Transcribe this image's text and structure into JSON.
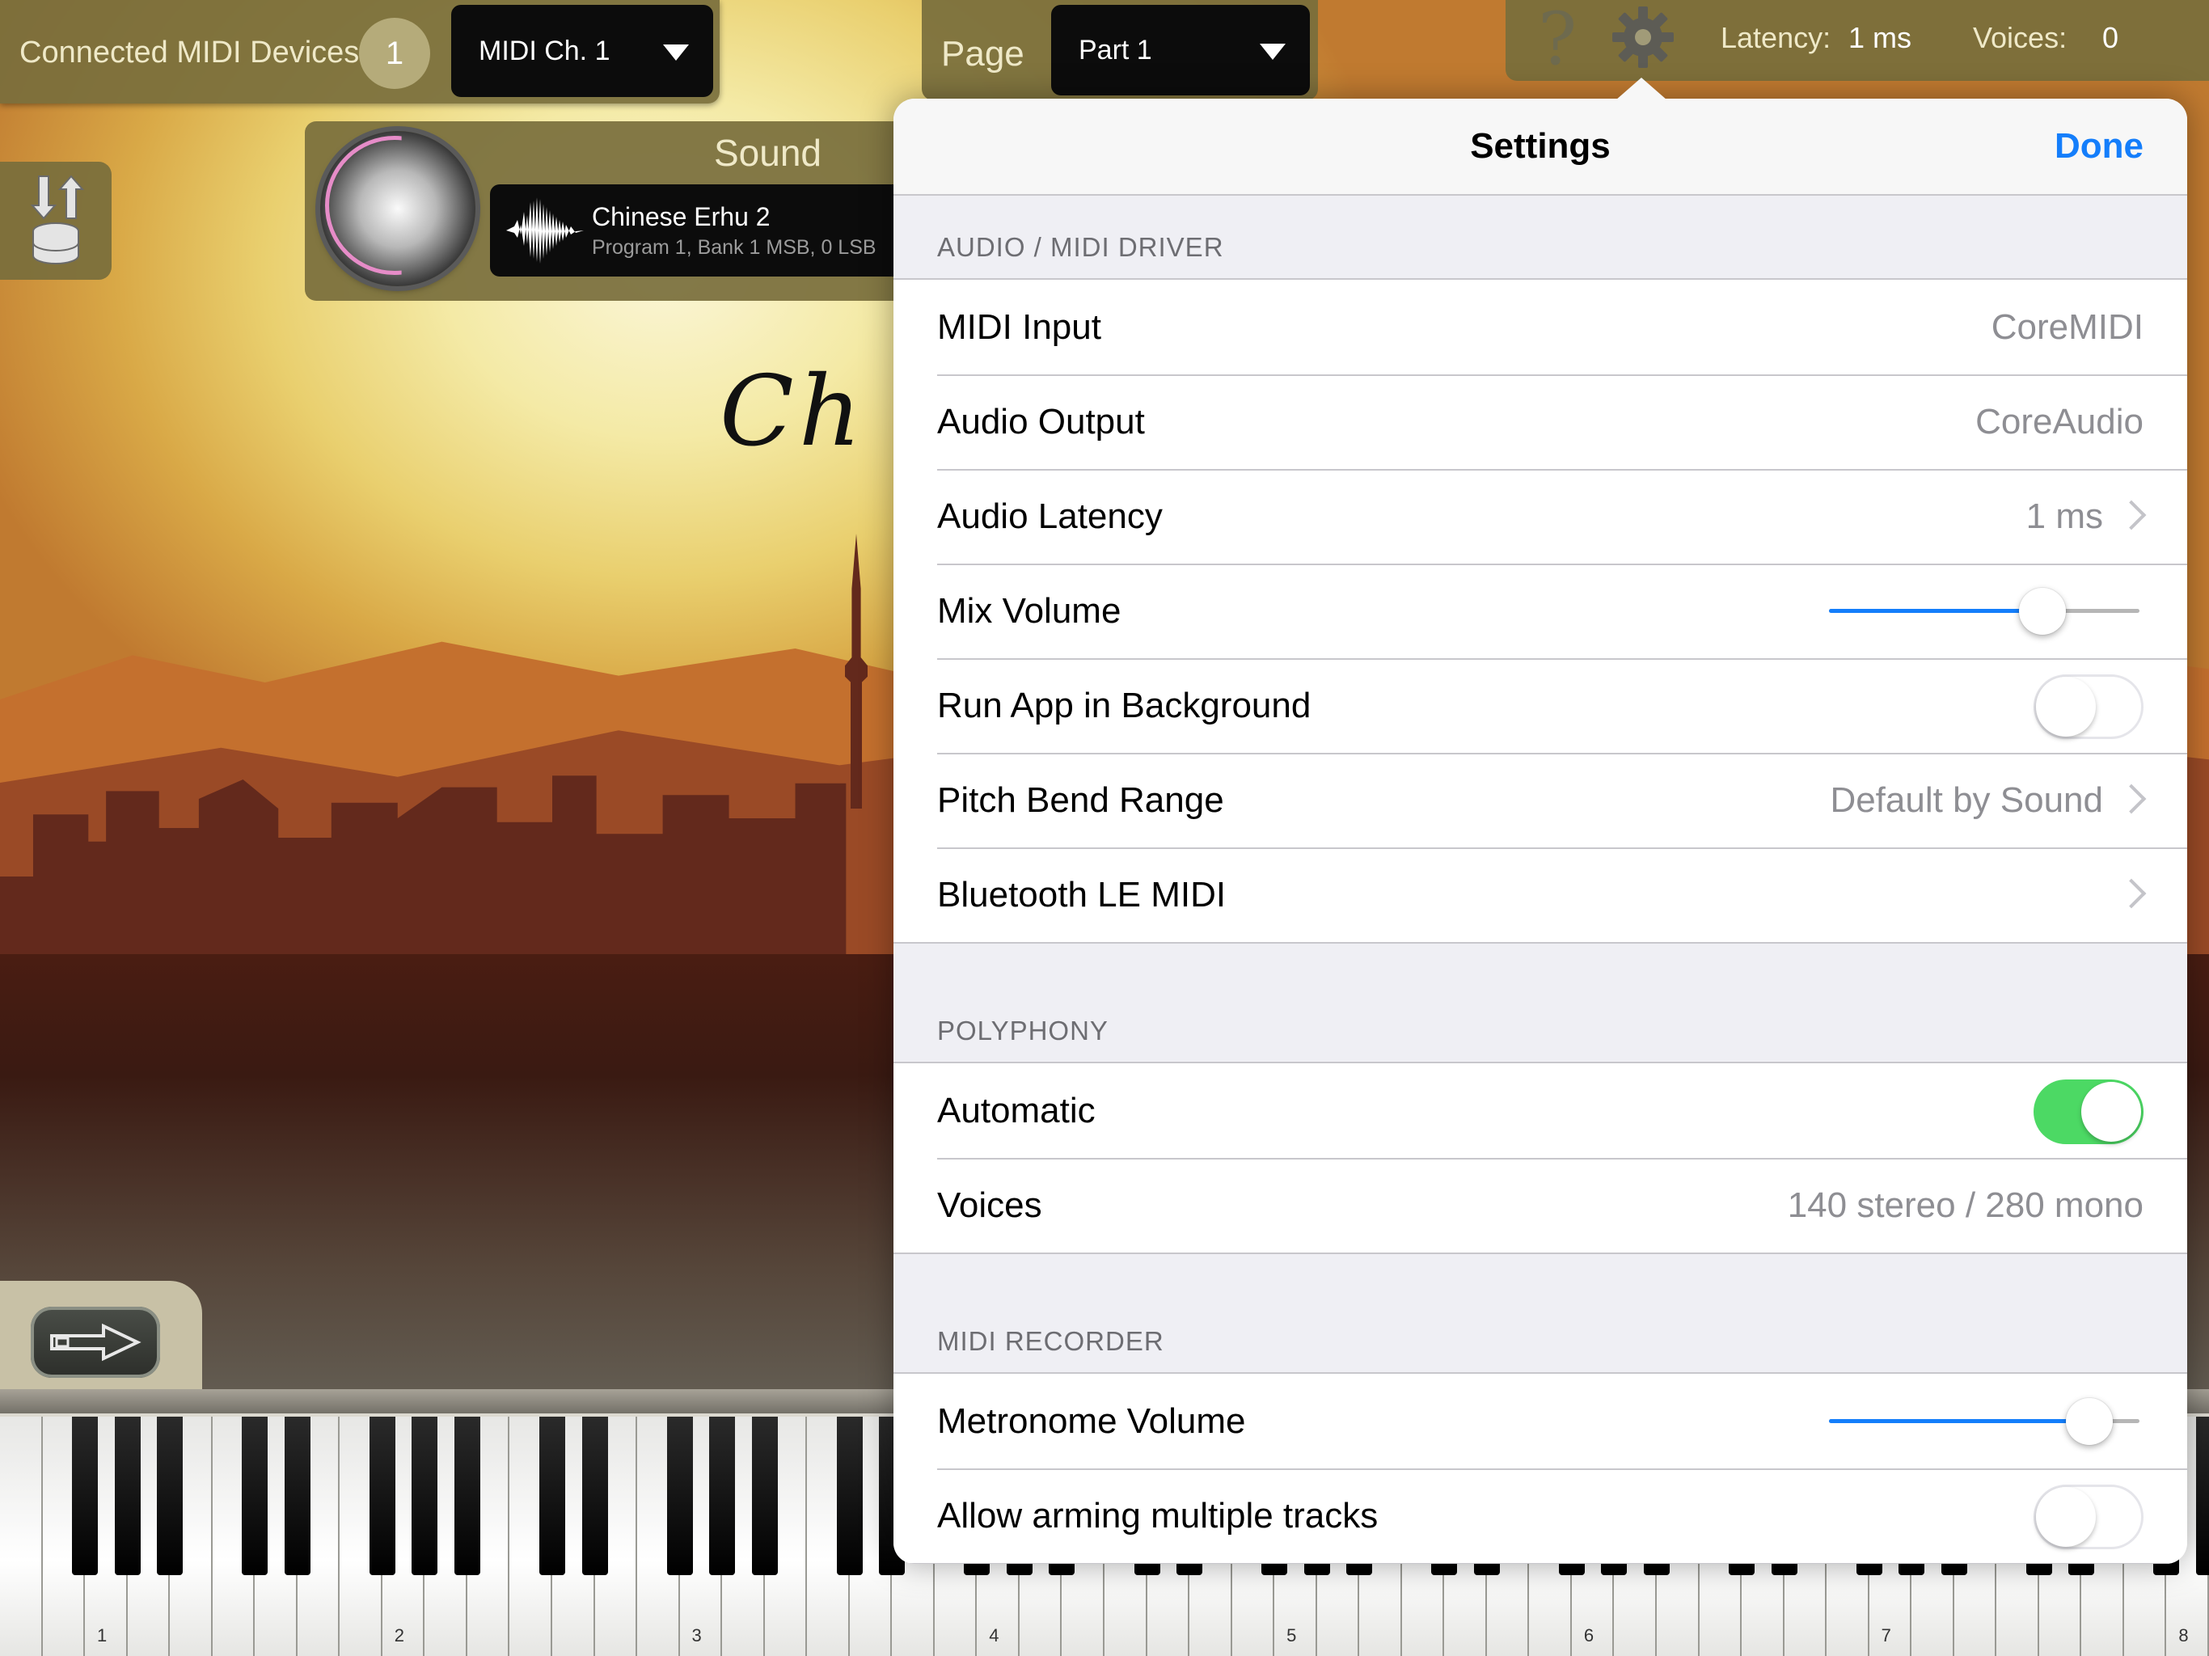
{
  "topbar": {
    "connected_label": "Connected MIDI Devices:",
    "connected_count": "1",
    "midi_channel": "MIDI Ch. 1",
    "page_label": "Page",
    "page_value": "Part 1",
    "help_glyph": "?",
    "latency_label": "Latency:",
    "latency_value": "1 ms",
    "voices_label": "Voices:",
    "voices_value": "0"
  },
  "sound": {
    "label": "Sound",
    "name": "Chinese Erhu 2",
    "details": "Program 1, Bank 1 MSB, 0 LSB"
  },
  "logo_text": "Ch",
  "keyboard": {
    "octave_labels": [
      "1",
      "2",
      "3",
      "4",
      "5",
      "6",
      "7",
      "8"
    ]
  },
  "settings": {
    "title": "Settings",
    "done": "Done",
    "sections": {
      "driver": {
        "header": "AUDIO / MIDI DRIVER",
        "midi_input_label": "MIDI Input",
        "midi_input_value": "CoreMIDI",
        "audio_output_label": "Audio Output",
        "audio_output_value": "CoreAudio",
        "latency_label": "Audio Latency",
        "latency_value": "1 ms",
        "mix_volume_label": "Mix Volume",
        "mix_volume_level": 0.72,
        "run_bg_label": "Run App in Background",
        "run_bg_on": false,
        "pitch_bend_label": "Pitch Bend Range",
        "pitch_bend_value": "Default by Sound",
        "ble_midi_label": "Bluetooth LE MIDI"
      },
      "polyphony": {
        "header": "POLYPHONY",
        "automatic_label": "Automatic",
        "automatic_on": true,
        "voices_label": "Voices",
        "voices_value": "140 stereo / 280 mono"
      },
      "recorder": {
        "header": "MIDI RECORDER",
        "metronome_label": "Metronome Volume",
        "metronome_level": 0.9,
        "arm_multi_label": "Allow arming multiple tracks",
        "arm_multi_on": false
      }
    }
  },
  "colors": {
    "accent": "#147efb",
    "switch_on": "#4cd964",
    "slider_fill": "#147efb",
    "knob_ring": "#e68cc8"
  },
  "icons": [
    "help-icon",
    "gear-icon",
    "sound-library-icon",
    "waveform-icon",
    "arrow-right-icon",
    "chevron-right-icon",
    "dropdown-triangle-icon"
  ]
}
